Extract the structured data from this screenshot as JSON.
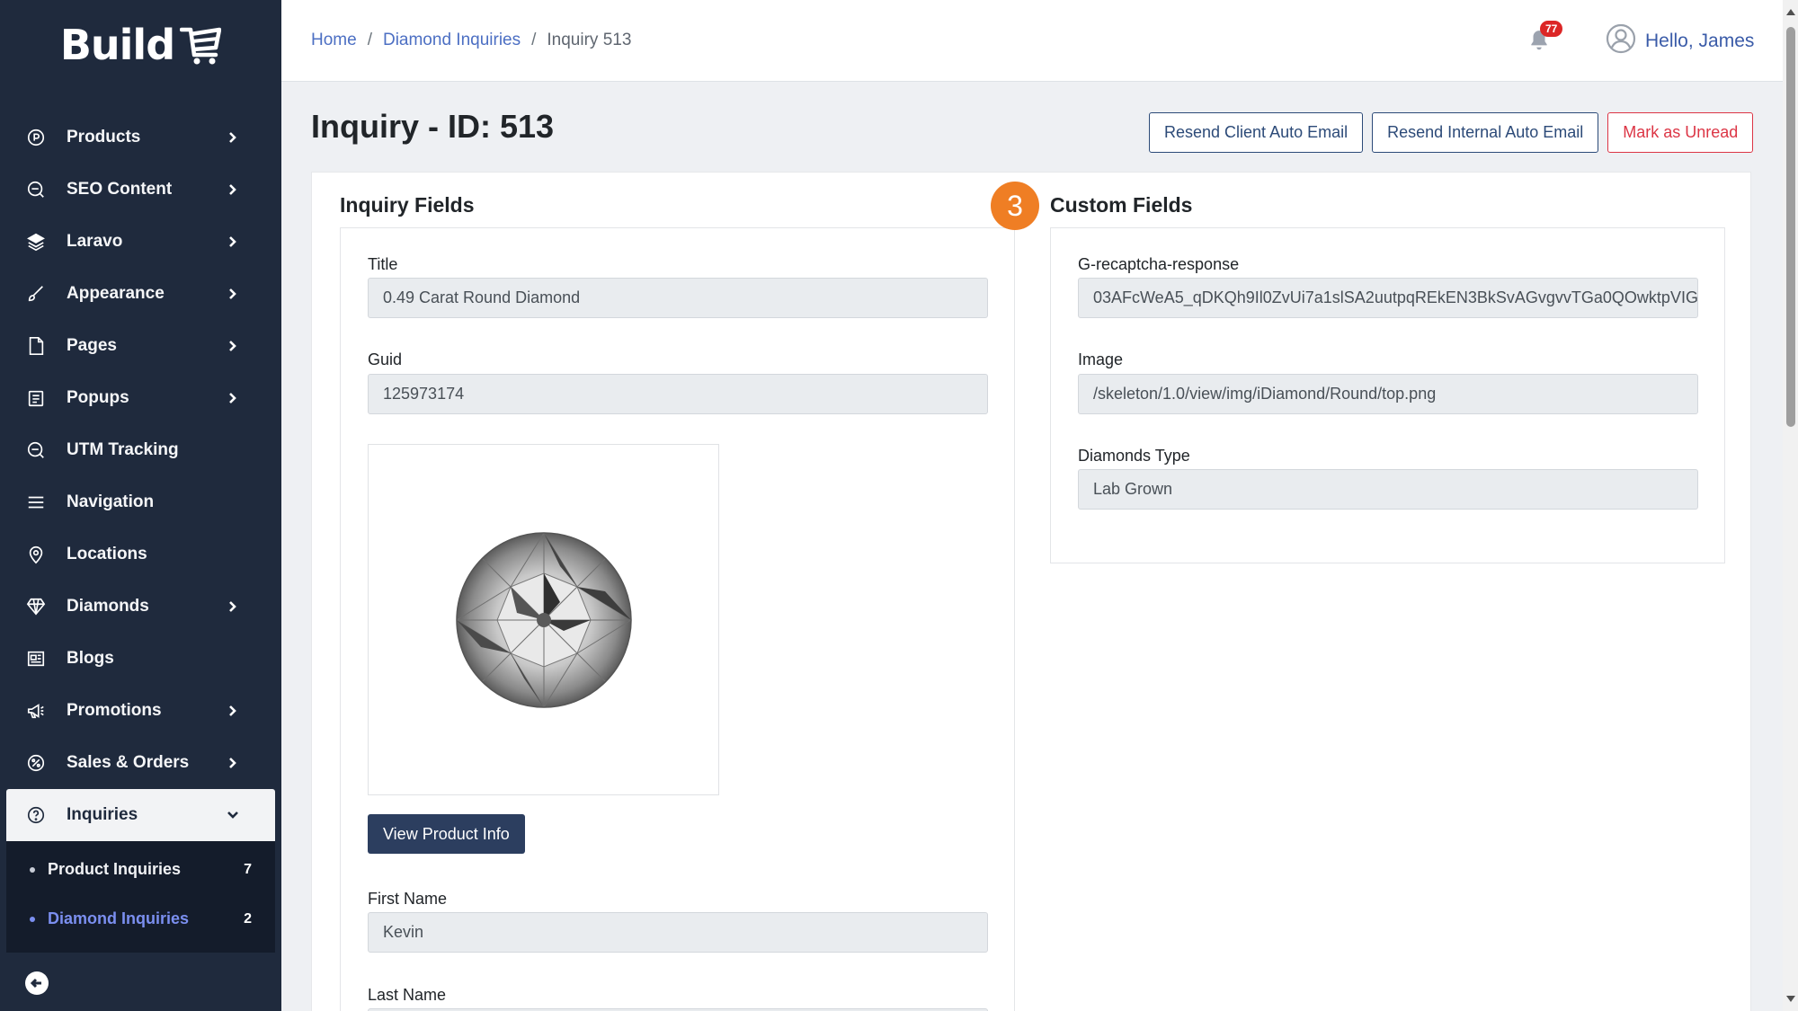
{
  "logo": {
    "text": "Build"
  },
  "sidebar": {
    "items": [
      {
        "label": "Products",
        "icon": "products-icon",
        "chevron": true
      },
      {
        "label": "SEO Content",
        "icon": "seo-icon",
        "chevron": true
      },
      {
        "label": "Laravo",
        "icon": "layers-icon",
        "chevron": true
      },
      {
        "label": "Appearance",
        "icon": "brush-icon",
        "chevron": true
      },
      {
        "label": "Pages",
        "icon": "page-icon",
        "chevron": true
      },
      {
        "label": "Popups",
        "icon": "popup-icon",
        "chevron": true
      },
      {
        "label": "UTM Tracking",
        "icon": "seo-icon",
        "chevron": false
      },
      {
        "label": "Navigation",
        "icon": "menu-icon",
        "chevron": false
      },
      {
        "label": "Locations",
        "icon": "location-icon",
        "chevron": false
      },
      {
        "label": "Diamonds",
        "icon": "diamond-icon",
        "chevron": true
      },
      {
        "label": "Blogs",
        "icon": "newspaper-icon",
        "chevron": false
      },
      {
        "label": "Promotions",
        "icon": "megaphone-icon",
        "chevron": true
      },
      {
        "label": "Sales & Orders",
        "icon": "percent-icon",
        "chevron": true
      }
    ],
    "active": {
      "label": "Inquiries",
      "icon": "help-circle-icon"
    },
    "submenu": [
      {
        "label": "Product Inquiries",
        "count": "7"
      },
      {
        "label": "Diamond Inquiries",
        "count": "2"
      }
    ]
  },
  "breadcrumb": {
    "home": "Home",
    "section": "Diamond Inquiries",
    "current": "Inquiry 513",
    "sep": "/"
  },
  "header": {
    "notifications": "77",
    "greeting": "Hello, James"
  },
  "page": {
    "title": "Inquiry - ID: 513",
    "buttons": {
      "resend_client": "Resend Client Auto Email",
      "resend_internal": "Resend Internal Auto Email",
      "mark_unread": "Mark as Unread"
    }
  },
  "inquiry_fields": {
    "heading": "Inquiry Fields",
    "title_label": "Title",
    "title_value": "0.49 Carat Round Diamond",
    "guid_label": "Guid",
    "guid_value": "125973174",
    "view_product": "View Product Info",
    "first_name_label": "First Name",
    "first_name_value": "Kevin",
    "last_name_label": "Last Name"
  },
  "custom_fields": {
    "heading": "Custom Fields",
    "recaptcha_label": "G-recaptcha-response",
    "recaptcha_value": "03AFcWeA5_qDKQh9Il0ZvUi7a1slSA2uutpqREkEN3BkSvAGvgvvTGa0QOwktpVIG",
    "image_label": "Image",
    "image_value": "/skeleton/1.0/view/img/iDiamond/Round/top.png",
    "type_label": "Diamonds Type",
    "type_value": "Lab Grown"
  },
  "step_badge": "3",
  "colors": {
    "sidebar": "#1f2a3d",
    "accent": "#4c6fc3",
    "primary_button": "#2c3e5f",
    "danger": "#dc3545",
    "step": "#ef7e24"
  }
}
